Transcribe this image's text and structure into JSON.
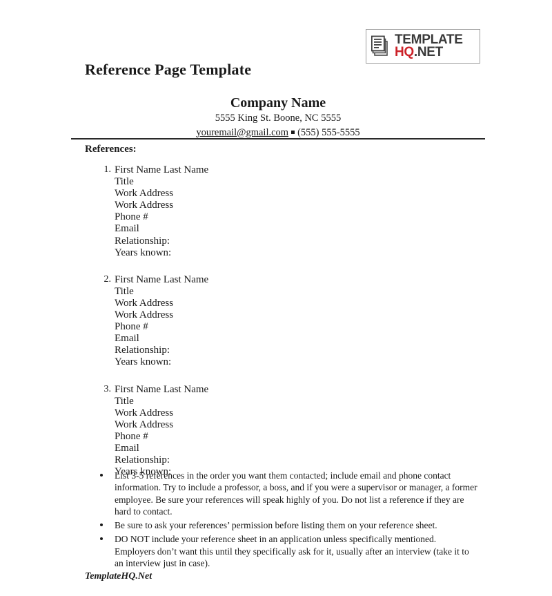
{
  "document": {
    "title": "Reference Page Template",
    "footer": "TemplateHQ.Net"
  },
  "logo": {
    "icon": "documents-icon",
    "line1": "TEMPLATE",
    "line2_hq": "HQ",
    "line2_net": ".NET",
    "color_red": "#cc2229",
    "color_dark": "#3a3a3a"
  },
  "header": {
    "company_name": "Company Name",
    "address": "5555 King St. Boone, NC 5555",
    "email": "youremail@gmail.com",
    "phone": "(555) 555-5555"
  },
  "references_section": {
    "heading": "References:",
    "items": [
      {
        "number": "1.",
        "lines": [
          "First Name Last Name",
          "Title",
          "Work Address",
          "Work Address",
          "Phone #",
          "Email",
          "Relationship:",
          "Years known:"
        ]
      },
      {
        "number": "2.",
        "lines": [
          "First Name Last Name",
          "Title",
          "Work Address",
          "Work Address",
          "Phone #",
          "Email",
          "Relationship:",
          "Years known:"
        ]
      },
      {
        "number": "3.",
        "lines": [
          "First Name Last Name",
          "Title",
          "Work Address",
          "Work Address",
          "Phone #",
          "Email",
          "Relationship:",
          "Years known:"
        ]
      }
    ]
  },
  "tips": [
    "List 3-5 references in the order you want them contacted; include email and phone contact information. Try to include a professor, a boss, and if you were a supervisor or manager, a former employee. Be sure your references will speak highly of you. Do not list a reference if they are hard to contact.",
    "Be sure to ask your references’ permission before listing them on your reference sheet.",
    "DO NOT include your reference sheet in an application unless specifically mentioned. Employers don’t want this until they specifically ask for it, usually after an interview (take it to an interview just in case)."
  ]
}
